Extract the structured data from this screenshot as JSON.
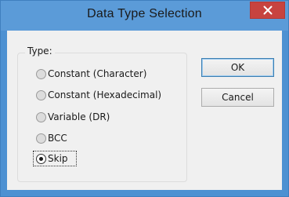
{
  "window": {
    "title": "Data Type Selection",
    "close_glyph": "✕"
  },
  "group": {
    "label": "Type:",
    "options": [
      {
        "label": "Constant (Character)",
        "checked": false
      },
      {
        "label": "Constant (Hexadecimal)",
        "checked": false
      },
      {
        "label": "Variable (DR)",
        "checked": false
      },
      {
        "label": "BCC",
        "checked": false
      },
      {
        "label": "Skip",
        "checked": true
      }
    ]
  },
  "buttons": {
    "ok_label": "OK",
    "cancel_label": "Cancel"
  },
  "colors": {
    "title_bar": "#5b9bd8",
    "close_button": "#c7433f",
    "client_background": "#f0f0f0"
  }
}
